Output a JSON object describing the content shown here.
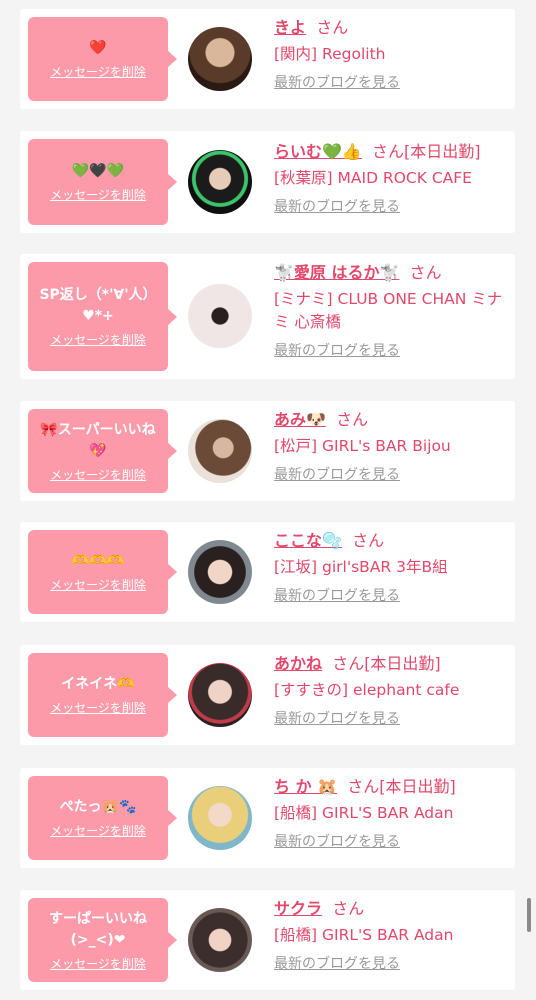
{
  "actions": {
    "delete_label": "メッセージを削除",
    "blog_label": "最新のブログを見る"
  },
  "colors": {
    "accent": "#e1486b",
    "bubble": "#fc9aa9"
  },
  "items": [
    {
      "message": "❤️",
      "name": "きよ",
      "suffix": "さん",
      "shop": "[関内] Regolith"
    },
    {
      "message": "💚🖤💚",
      "name": "らいむ💚👍",
      "suffix": "さん[本日出勤]",
      "shop": "[秋葉原] MAID ROCK CAFE"
    },
    {
      "message": "SP返し（*'∀'人）♥*+",
      "name": "🐩愛原 はるか🐩",
      "suffix": "さん",
      "shop": "[ミナミ] CLUB ONE CHAN ミナミ 心斎橋"
    },
    {
      "message": "🎀スーパーいいね💖",
      "name": "あみ🐶",
      "suffix": "さん",
      "shop": "[松戸] GIRL's BAR Bijou"
    },
    {
      "message": "🫶🫶🫶",
      "name": "ここな🫧",
      "suffix": "さん",
      "shop": "[江坂] girl'sBAR 3年B組"
    },
    {
      "message": "イネイネ🫶",
      "name": "あかね",
      "suffix": "さん[本日出勤]",
      "shop": "[すすきの] elephant cafe"
    },
    {
      "message": "ぺたっ🐹🐾",
      "name": "ち か 🐹",
      "suffix": "さん[本日出勤]",
      "shop": "[船橋] GIRL'S BAR Adan"
    },
    {
      "message": "すーぱーいいね(>_<)❤",
      "name": "サクラ",
      "suffix": "さん",
      "shop": "[船橋] GIRL'S BAR Adan"
    }
  ]
}
